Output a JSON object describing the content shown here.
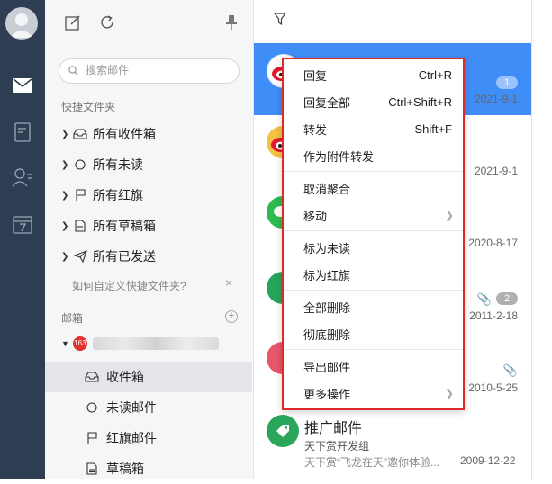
{
  "sidebar": {
    "search_placeholder": "搜索邮件",
    "favorites_label": "快捷文件夹",
    "favorites": [
      {
        "label": "所有收件箱",
        "icon": "inbox-icon"
      },
      {
        "label": "所有未读",
        "icon": "circle-icon"
      },
      {
        "label": "所有红旗",
        "icon": "flag-icon"
      },
      {
        "label": "所有草稿箱",
        "icon": "draft-icon"
      },
      {
        "label": "所有已发送",
        "icon": "sent-icon"
      }
    ],
    "hint": "如何自定义快捷文件夹?",
    "hint_close": "×",
    "mailbox_label": "邮箱",
    "mailbox_add": "+",
    "account_badge": "163",
    "account_folders": [
      {
        "label": "收件箱",
        "icon": "inbox-icon",
        "active": true
      },
      {
        "label": "未读邮件",
        "icon": "circle-icon",
        "active": false
      },
      {
        "label": "红旗邮件",
        "icon": "flag-icon",
        "active": false
      },
      {
        "label": "草稿箱",
        "icon": "draft-icon",
        "active": false
      }
    ]
  },
  "message_list": {
    "items": [
      {
        "date": "2021-9-1",
        "count": "1",
        "selected": true,
        "avatar_color": "#ffffff"
      },
      {
        "date": "2021-9-1",
        "avatar_color": "#f5c245"
      },
      {
        "date": "2020-8-17",
        "avatar_color": "#2dbb4e"
      },
      {
        "date": "2011-2-18",
        "count": "2",
        "attachment": true,
        "avatar_color": "#26a65b"
      },
      {
        "date": "2010-5-25",
        "attachment": true,
        "avatar_color": "#e8566b"
      }
    ],
    "last": {
      "subject": "推广邮件",
      "from": "天下赏开发组",
      "preview": "天下赏“飞龙在天”邀你体验...",
      "date": "2009-12-22",
      "avatar_color": "#2aa65b"
    }
  },
  "context_menu": {
    "groups": [
      [
        {
          "label": "回复",
          "shortcut": "Ctrl+R"
        },
        {
          "label": "回复全部",
          "shortcut": "Ctrl+Shift+R"
        },
        {
          "label": "转发",
          "shortcut": "Shift+F"
        },
        {
          "label": "作为附件转发",
          "shortcut": ""
        }
      ],
      [
        {
          "label": "取消聚合",
          "shortcut": ""
        },
        {
          "label": "移动",
          "shortcut": "",
          "submenu": true
        }
      ],
      [
        {
          "label": "标为未读",
          "shortcut": ""
        },
        {
          "label": "标为红旗",
          "shortcut": ""
        }
      ],
      [
        {
          "label": "全部删除",
          "shortcut": ""
        },
        {
          "label": "彻底删除",
          "shortcut": ""
        }
      ],
      [
        {
          "label": "导出邮件",
          "shortcut": ""
        },
        {
          "label": "更多操作",
          "shortcut": "",
          "submenu": true
        }
      ]
    ]
  },
  "colors": {
    "rail": "#2e3d51",
    "selection": "#3f8ef7",
    "menu_border": "#e02a2a"
  }
}
